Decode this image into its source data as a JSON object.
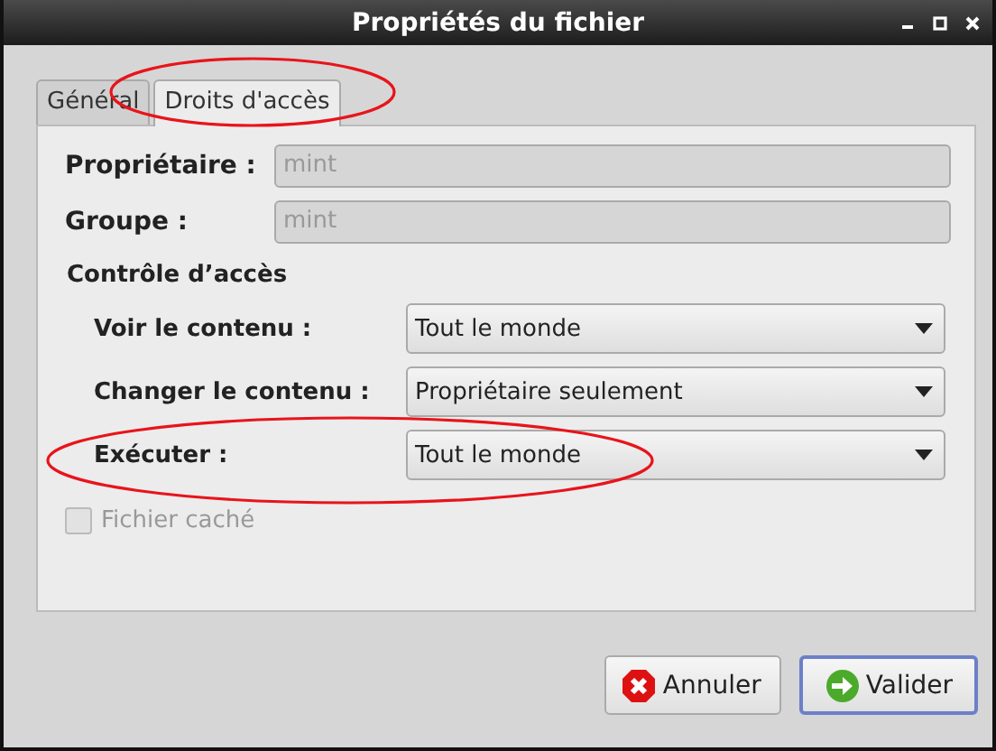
{
  "window": {
    "title": "Propriétés du fichier"
  },
  "tabs": [
    {
      "label": "Général",
      "selected": false,
      "highlighted": false
    },
    {
      "label": "Droits d'accès",
      "selected": true,
      "highlighted": true
    }
  ],
  "fields": [
    {
      "label": "Propriétaire :",
      "value": "mint",
      "disabled": true
    },
    {
      "label": "Groupe :",
      "value": "mint",
      "disabled": true
    }
  ],
  "access_control": {
    "title": "Contrôle d’accès",
    "rows": [
      {
        "label": "Voir le contenu :",
        "value": "Tout le monde"
      },
      {
        "label": "Changer le contenu :",
        "value": "Propriétaire seulement"
      },
      {
        "label": "Exécuter :",
        "value": "Tout le monde",
        "highlighted": true
      }
    ]
  },
  "hidden_file": {
    "label": "Fichier caché",
    "checked": false,
    "disabled": true
  },
  "buttons": [
    {
      "label": "Annuler",
      "kind": "cancel",
      "focused": false
    },
    {
      "label": "Valider",
      "kind": "ok",
      "focused": true
    }
  ]
}
